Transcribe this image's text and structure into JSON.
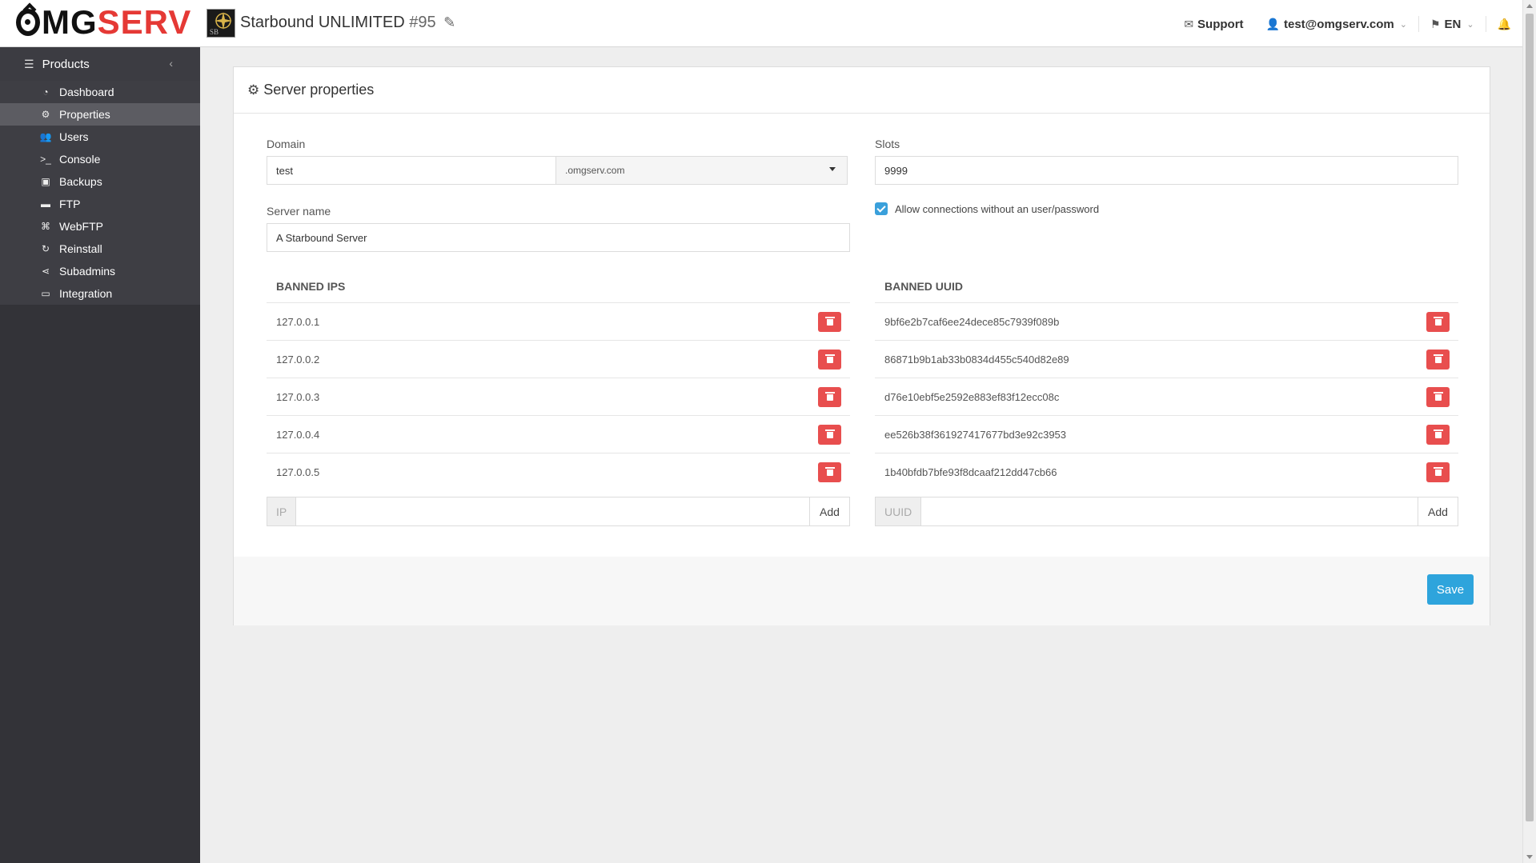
{
  "brand": {
    "logo_prefix": "MG",
    "logo_suffix": "SERV"
  },
  "header": {
    "server_title": "Starbound UNLIMITED",
    "server_number": "#95",
    "game_thumb_text": "SB",
    "support_label": "Support",
    "user_email": "test@omgserv.com",
    "language": "EN"
  },
  "sidebar": {
    "section_label": "Products",
    "items": [
      {
        "label": "Dashboard",
        "icon": "dashboard-icon",
        "glyph": "◔"
      },
      {
        "label": "Properties",
        "icon": "gear-icon",
        "glyph": "⚙"
      },
      {
        "label": "Users",
        "icon": "users-icon",
        "glyph": "👥"
      },
      {
        "label": "Console",
        "icon": "terminal-icon",
        "glyph": ">_"
      },
      {
        "label": "Backups",
        "icon": "save-icon",
        "glyph": "▣"
      },
      {
        "label": "FTP",
        "icon": "folder-icon",
        "glyph": "▬"
      },
      {
        "label": "WebFTP",
        "icon": "sitemap-icon",
        "glyph": "⌘"
      },
      {
        "label": "Reinstall",
        "icon": "refresh-icon",
        "glyph": "↻"
      },
      {
        "label": "Subadmins",
        "icon": "share-icon",
        "glyph": "⋖"
      },
      {
        "label": "Integration",
        "icon": "desktop-icon",
        "glyph": "▭"
      }
    ],
    "active_index": 1
  },
  "panel": {
    "title": "Server properties",
    "domain_label": "Domain",
    "domain_value": "test",
    "domain_suffix": ".omgserv.com",
    "slots_label": "Slots",
    "slots_value": "9999",
    "server_name_label": "Server name",
    "server_name_value": "A Starbound Server",
    "allow_anonymous_label": "Allow connections without an user/password",
    "allow_anonymous_checked": true,
    "banned_ips_title": "BANNED IPS",
    "banned_ips": [
      "127.0.0.1",
      "127.0.0.2",
      "127.0.0.3",
      "127.0.0.4",
      "127.0.0.5"
    ],
    "ip_addon": "IP",
    "banned_uuid_title": "BANNED UUID",
    "banned_uuids": [
      "9bf6e2b7caf6ee24dece85c7939f089b",
      "86871b9b1ab33b0834d455c540d82e89",
      "d76e10ebf5e2592e883ef83f12ecc08c",
      "ee526b38f361927417677bd3e92c3953",
      "1b40bfdb7bfe93f8dcaaf212dd47cb66"
    ],
    "uuid_addon": "UUID",
    "add_label": "Add",
    "save_label": "Save"
  },
  "colors": {
    "sidebar_bg": "#333338",
    "sidebar_active": "#5c5c62",
    "danger": "#e84e4e",
    "primary": "#2ea4dc",
    "logo_accent": "#e53935"
  }
}
